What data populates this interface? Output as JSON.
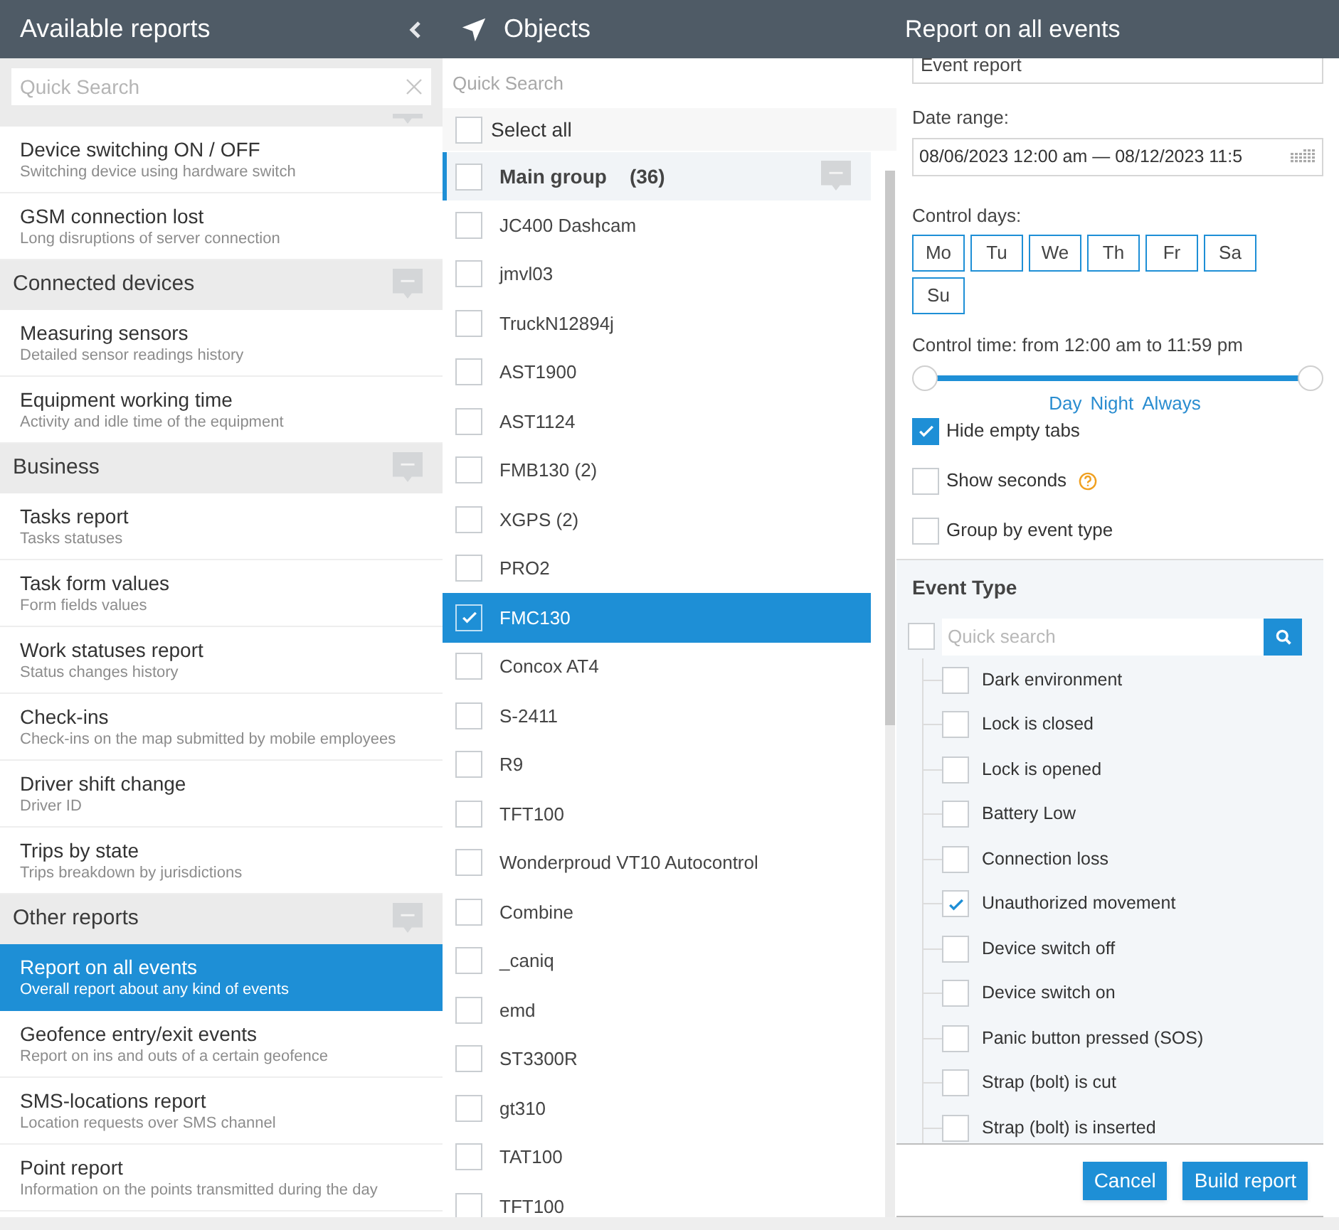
{
  "reports_panel": {
    "title": "Available reports",
    "search": {
      "placeholder": "Quick Search"
    },
    "items": [
      {
        "kind": "group_edge"
      },
      {
        "kind": "report",
        "title": "Device switching ON / OFF",
        "description": "Switching device using hardware switch",
        "selected": false
      },
      {
        "kind": "report",
        "title": "GSM connection lost",
        "description": "Long disruptions of server connection",
        "selected": false
      },
      {
        "kind": "group",
        "title": "Connected devices"
      },
      {
        "kind": "report",
        "title": "Measuring sensors",
        "description": "Detailed sensor readings history",
        "selected": false
      },
      {
        "kind": "report",
        "title": "Equipment working time",
        "description": "Activity and idle time of the equipment",
        "selected": false
      },
      {
        "kind": "group",
        "title": "Business"
      },
      {
        "kind": "report",
        "title": "Tasks report",
        "description": "Tasks statuses",
        "selected": false
      },
      {
        "kind": "report",
        "title": "Task form values",
        "description": "Form fields values",
        "selected": false
      },
      {
        "kind": "report",
        "title": "Work statuses report",
        "description": "Status changes history",
        "selected": false
      },
      {
        "kind": "report",
        "title": "Check-ins",
        "description": "Check-ins on the map submitted by mobile employees",
        "selected": false
      },
      {
        "kind": "report",
        "title": "Driver shift change",
        "description": "Driver ID",
        "selected": false
      },
      {
        "kind": "report",
        "title": "Trips by state",
        "description": "Trips breakdown by jurisdictions",
        "selected": false
      },
      {
        "kind": "group",
        "title": "Other reports"
      },
      {
        "kind": "report",
        "title": "Report on all events",
        "description": "Overall report about any kind of events",
        "selected": true
      },
      {
        "kind": "report",
        "title": "Geofence entry/exit events",
        "description": "Report on ins and outs of a certain geofence",
        "selected": false
      },
      {
        "kind": "report",
        "title": "SMS-locations report",
        "description": "Location requests over SMS channel",
        "selected": false
      },
      {
        "kind": "report",
        "title": "Point report",
        "description": "Information on the points transmitted during the day",
        "selected": false
      }
    ]
  },
  "objects_panel": {
    "title": "Objects",
    "search": {
      "placeholder": "Quick Search"
    },
    "select_all": {
      "label": "Select all",
      "checked": false
    },
    "group": {
      "name": "Main group",
      "count": "(36)",
      "checked": false
    },
    "items": [
      {
        "name": "JC400 Dashcam",
        "checked": false,
        "selected": false
      },
      {
        "name": "jmvl03",
        "checked": false,
        "selected": false
      },
      {
        "name": "TruckN12894j",
        "checked": false,
        "selected": false
      },
      {
        "name": "AST1900",
        "checked": false,
        "selected": false
      },
      {
        "name": "AST1124",
        "checked": false,
        "selected": false
      },
      {
        "name": "FMB130 (2)",
        "checked": false,
        "selected": false
      },
      {
        "name": "XGPS (2)",
        "checked": false,
        "selected": false
      },
      {
        "name": "PRO2",
        "checked": false,
        "selected": false
      },
      {
        "name": "FMC130",
        "checked": true,
        "selected": true
      },
      {
        "name": "Concox AT4",
        "checked": false,
        "selected": false
      },
      {
        "name": "S-2411",
        "checked": false,
        "selected": false
      },
      {
        "name": "R9",
        "checked": false,
        "selected": false
      },
      {
        "name": "TFT100",
        "checked": false,
        "selected": false
      },
      {
        "name": "Wonderproud VT10 Autocontrol",
        "checked": false,
        "selected": false
      },
      {
        "name": "Combine",
        "checked": false,
        "selected": false
      },
      {
        "name": "_caniq",
        "checked": false,
        "selected": false
      },
      {
        "name": "emd",
        "checked": false,
        "selected": false
      },
      {
        "name": "ST3300R",
        "checked": false,
        "selected": false
      },
      {
        "name": "gt310",
        "checked": false,
        "selected": false
      },
      {
        "name": "TAT100",
        "checked": false,
        "selected": false
      },
      {
        "name": "TFT100",
        "checked": false,
        "selected": false
      }
    ]
  },
  "report_form": {
    "title": "Report on all events",
    "report_name": {
      "value": "Event report"
    },
    "date_range": {
      "label": "Date range:",
      "value": "08/06/2023 12:00 am — 08/12/2023 11:5"
    },
    "control_days": {
      "label": "Control days:",
      "days": [
        "Mo",
        "Tu",
        "We",
        "Th",
        "Fr",
        "Sa",
        "Su"
      ]
    },
    "control_time": {
      "label": "Control time: from 12:00 am to 11:59 pm",
      "level": 1,
      "presets": [
        "Day",
        "Night",
        "Always"
      ]
    },
    "options": [
      {
        "label": "Hide empty tabs",
        "checked": true,
        "help": false
      },
      {
        "label": "Show seconds",
        "checked": false,
        "help": true
      },
      {
        "label": "Group by event type",
        "checked": false,
        "help": false
      }
    ],
    "event_type": {
      "title": "Event Type",
      "search": {
        "placeholder": "Quick search"
      },
      "all_checked": false,
      "items": [
        {
          "label": "Dark environment",
          "checked": false
        },
        {
          "label": "Lock is closed",
          "checked": false
        },
        {
          "label": "Lock is opened",
          "checked": false
        },
        {
          "label": "Battery Low",
          "checked": false
        },
        {
          "label": "Connection loss",
          "checked": false
        },
        {
          "label": "Unauthorized movement",
          "checked": true
        },
        {
          "label": "Device switch off",
          "checked": false
        },
        {
          "label": "Device switch on",
          "checked": false
        },
        {
          "label": "Panic button pressed (SOS)",
          "checked": false
        },
        {
          "label": "Strap (bolt) is cut",
          "checked": false
        },
        {
          "label": "Strap (bolt) is inserted",
          "checked": false
        }
      ]
    },
    "buttons": [
      {
        "label": "Cancel"
      },
      {
        "label": "Build report"
      }
    ]
  }
}
